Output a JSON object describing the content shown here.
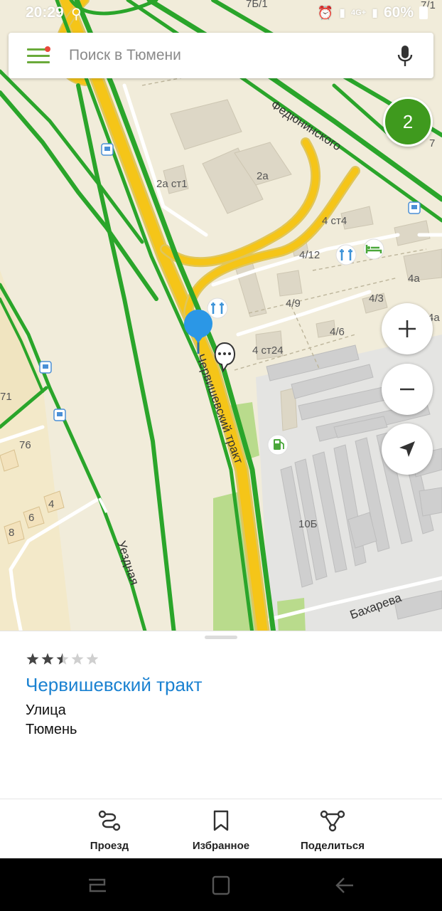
{
  "status": {
    "time": "20:29",
    "battery": "60%"
  },
  "search": {
    "placeholder": "Поиск в Тюмени"
  },
  "map": {
    "cluster_count": "2",
    "labels": {
      "street_fedyuninskogo": "Федюнинского",
      "street_chervishevsky": "Червишевский тракт",
      "street_ueznaya": "Уездная",
      "street_bakhareva": "Бахарева",
      "b_2a_st1": "2а ст1",
      "b_2a": "2а",
      "b_4st4": "4 ст4",
      "b_4_12": "4/12",
      "b_4a": "4а",
      "b_4_3": "4/3",
      "b_4_9": "4/9",
      "b_4_6": "4/6",
      "b_4st24": "4 ст24",
      "b_10b": "10Б",
      "b_71": "71",
      "b_76": "76",
      "b_4": "4",
      "b_6": "6",
      "b_8": "8",
      "b_7b1": "7Б/1",
      "b_7_1": "7/1",
      "b_7": "7",
      "b_4a_edge": "4а"
    }
  },
  "place": {
    "rating": 2.5,
    "rating_max": 5,
    "name": "Червишевский тракт",
    "type": "Улица",
    "city": "Тюмень"
  },
  "actions": {
    "route": "Проезд",
    "favorites": "Избранное",
    "share": "Поделиться"
  },
  "colors": {
    "accent_green": "#3f9a1e",
    "link_blue": "#1b82d1",
    "road_yellow": "#f5c518",
    "traffic_green": "#2aa52a"
  }
}
